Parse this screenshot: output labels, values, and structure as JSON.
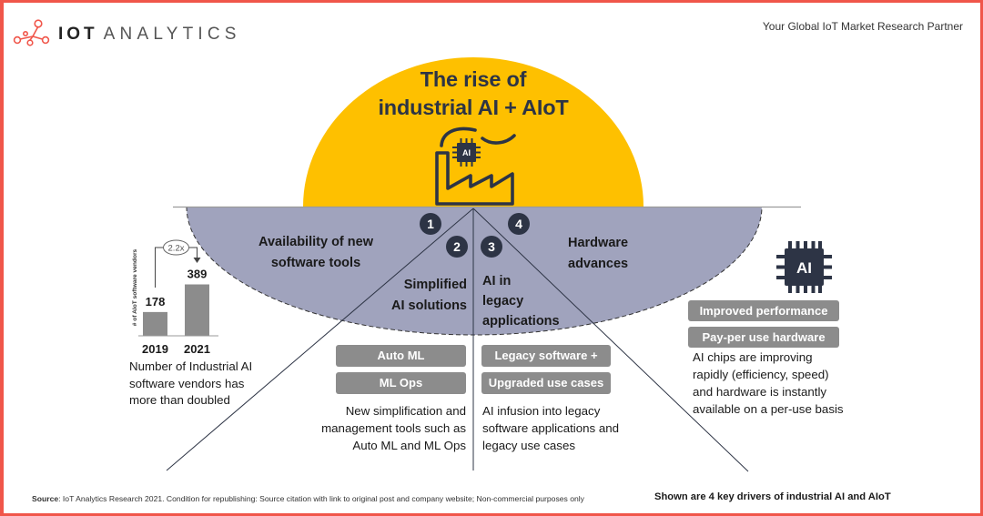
{
  "header": {
    "logo_bold": "IOT",
    "logo_light": "ANALYTICS",
    "logo_icon": "network-nodes-icon",
    "tagline": "Your Global IoT Market Research Partner"
  },
  "title": {
    "line1": "The rise of",
    "line2": "industrial AI + AIoT"
  },
  "center_icon": {
    "icon": "factory-with-ai-chip-icon",
    "chip_label": "AI"
  },
  "drivers": [
    {
      "number": "1",
      "label": [
        "Availability of new",
        "software tools"
      ],
      "caption": [
        "Number of Industrial AI",
        "software vendors has",
        "more than doubled"
      ]
    },
    {
      "number": "2",
      "label": [
        "Simplified",
        "AI solutions"
      ],
      "tags": [
        "Auto ML",
        "ML Ops"
      ],
      "description": [
        "New simplification and",
        "management tools such as",
        "Auto ML and ML Ops"
      ]
    },
    {
      "number": "3",
      "label": [
        "AI in",
        "legacy",
        "applications"
      ],
      "tags": [
        "Legacy software +",
        "Upgraded use cases"
      ],
      "description": [
        "AI infusion into legacy",
        "software applications and",
        "legacy use cases"
      ]
    },
    {
      "number": "4",
      "label": [
        "Hardware",
        "advances"
      ],
      "icon": "ai-chip-icon",
      "chip_label": "AI",
      "tags": [
        "Improved performance",
        "Pay-per use hardware"
      ],
      "description": [
        "AI chips are improving",
        "rapidly (efficiency, speed)",
        "and hardware is instantly",
        "available on a per-use basis"
      ]
    }
  ],
  "chart_data": {
    "type": "bar",
    "title": "",
    "categories": [
      "2019",
      "2021"
    ],
    "values": [
      178,
      389
    ],
    "xlabel": "",
    "ylabel": "# of AIoT software vendors",
    "ylim": [
      0,
      389
    ],
    "annotation": "2.2x",
    "grid": false,
    "legend": "none"
  },
  "footer": {
    "source_label": "Source",
    "source_text": ": IoT Analytics Research 2021. Condition for republishing: Source citation with link to original post and company website; Non-commercial purposes only",
    "key_note": "Shown are 4 key drivers of industrial AI and AIoT"
  },
  "colors": {
    "border": "#f0564a",
    "logo": "#f0564a",
    "sun": "#fec000",
    "horizon": "#a0a3bd",
    "dark": "#2d3445",
    "tag": "#8c8c8c"
  }
}
